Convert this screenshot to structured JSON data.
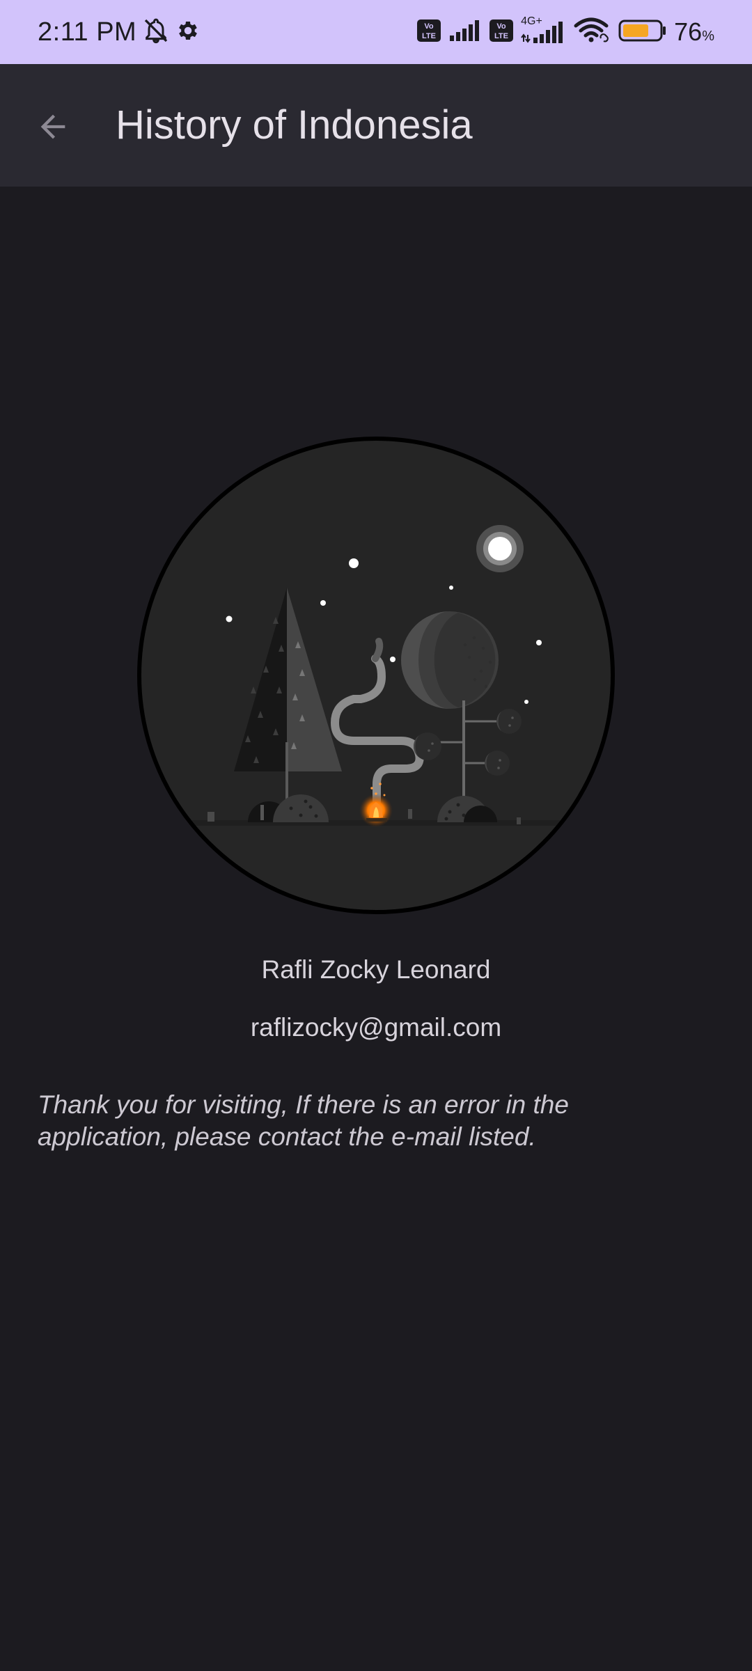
{
  "status_bar": {
    "time": "2:11 PM",
    "battery_percent": "76",
    "battery_suffix": "%",
    "network_label": "4G+",
    "volte_label": "Vo LTE",
    "icons": [
      "bell-off-icon",
      "gear-icon",
      "volte-icon",
      "signal-icon",
      "wifi-icon",
      "battery-icon"
    ]
  },
  "app_bar": {
    "title": "History of Indonesia",
    "back_icon": "arrow-left-icon"
  },
  "profile": {
    "name": "Rafli Zocky Leonard",
    "email": "raflizocky@gmail.com",
    "illustration": "night-forest-campfire-illustration"
  },
  "message": {
    "text": "Thank you for visiting, If there is an error in the application, please contact the e-mail listed."
  },
  "colors": {
    "status_bar_bg": "#d2c3fb",
    "app_bar_bg": "#2a2931",
    "page_bg": "#1c1b20",
    "text_primary": "#e6e1e9",
    "battery_fill": "#f5a623",
    "campfire": "#ff8a1f"
  }
}
